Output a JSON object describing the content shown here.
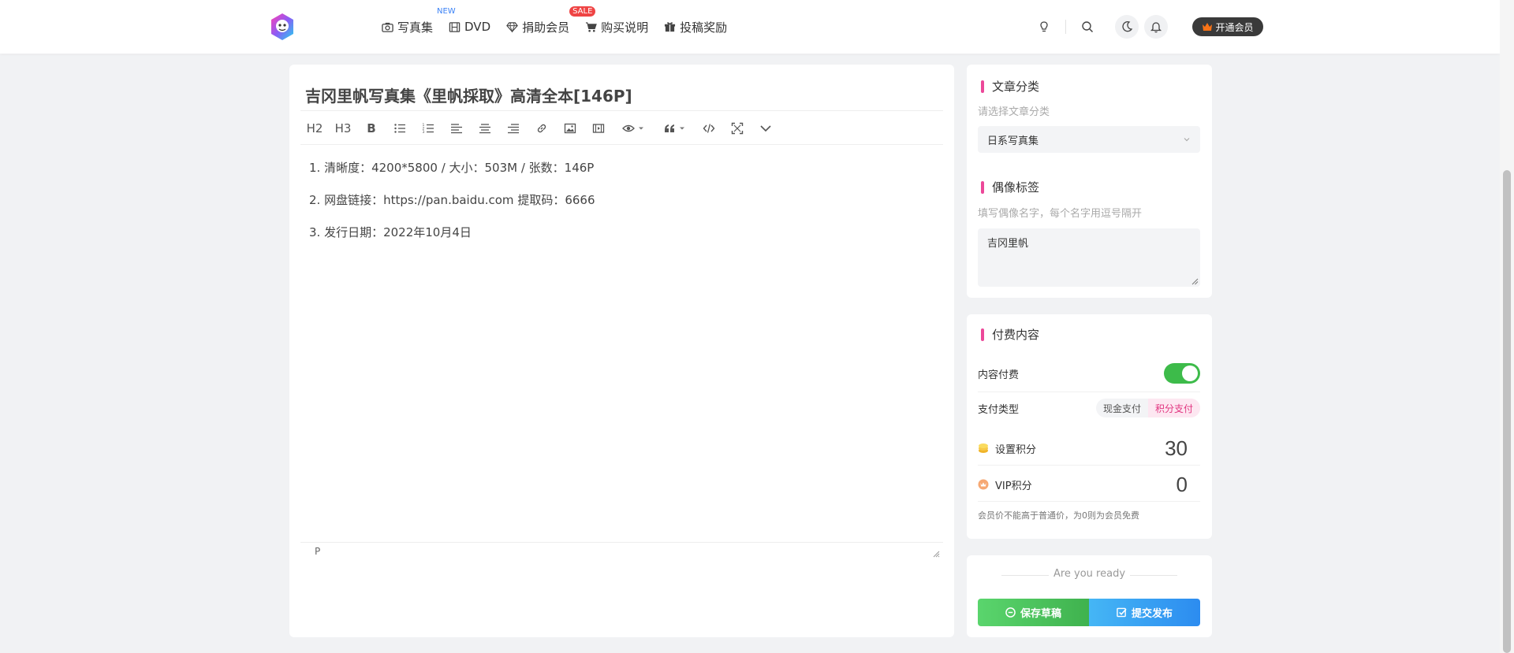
{
  "nav": {
    "items": [
      {
        "label": "写真集",
        "icon": "camera-icon",
        "badge": "NEW"
      },
      {
        "label": "DVD",
        "icon": "film-icon",
        "badge": ""
      },
      {
        "label": "捐助会员",
        "icon": "diamond-icon",
        "badge": "SALE"
      },
      {
        "label": "购买说明",
        "icon": "cart-icon",
        "badge": ""
      },
      {
        "label": "投稿奖励",
        "icon": "gift-icon",
        "badge": ""
      }
    ]
  },
  "header": {
    "vip_button": "开通会员"
  },
  "editor": {
    "title": "吉冈里帆写真集《里帆採取》高清全本[146P]",
    "toolbar": {
      "h2": "H2",
      "h3": "H3",
      "bold": "B"
    },
    "content": [
      "1. 清晰度：4200*5800 / 大小：503M / 张数：146P",
      "2. 网盘链接：https://pan.baidu.com 提取码：6666",
      "3. 发行日期：2022年10月4日"
    ],
    "status_path": "P"
  },
  "category": {
    "title": "文章分类",
    "hint": "请选择文章分类",
    "selected": "日系写真集"
  },
  "tags": {
    "title": "偶像标签",
    "hint": "填写偶像名字，每个名字用逗号隔开",
    "value": "吉冈里帆"
  },
  "paid": {
    "title": "付费内容",
    "toggle_label": "内容付费",
    "toggle_on": true,
    "pay_type_label": "支付类型",
    "pay_options": [
      "现金支付",
      "积分支付"
    ],
    "pay_selected": "积分支付",
    "points_label": "设置积分",
    "points_value": "30",
    "vip_points_label": "VIP积分",
    "vip_points_value": "0",
    "note": "会员价不能高于普通价，为0则为会员免费"
  },
  "publish": {
    "ready_text": "Are you ready",
    "draft_label": "保存草稿",
    "submit_label": "提交发布"
  },
  "colors": {
    "accent_pink": "#ec4899",
    "toggle_green": "#3dbb4a",
    "draft_green": "#4fc35f",
    "submit_blue": "#3399f3"
  }
}
